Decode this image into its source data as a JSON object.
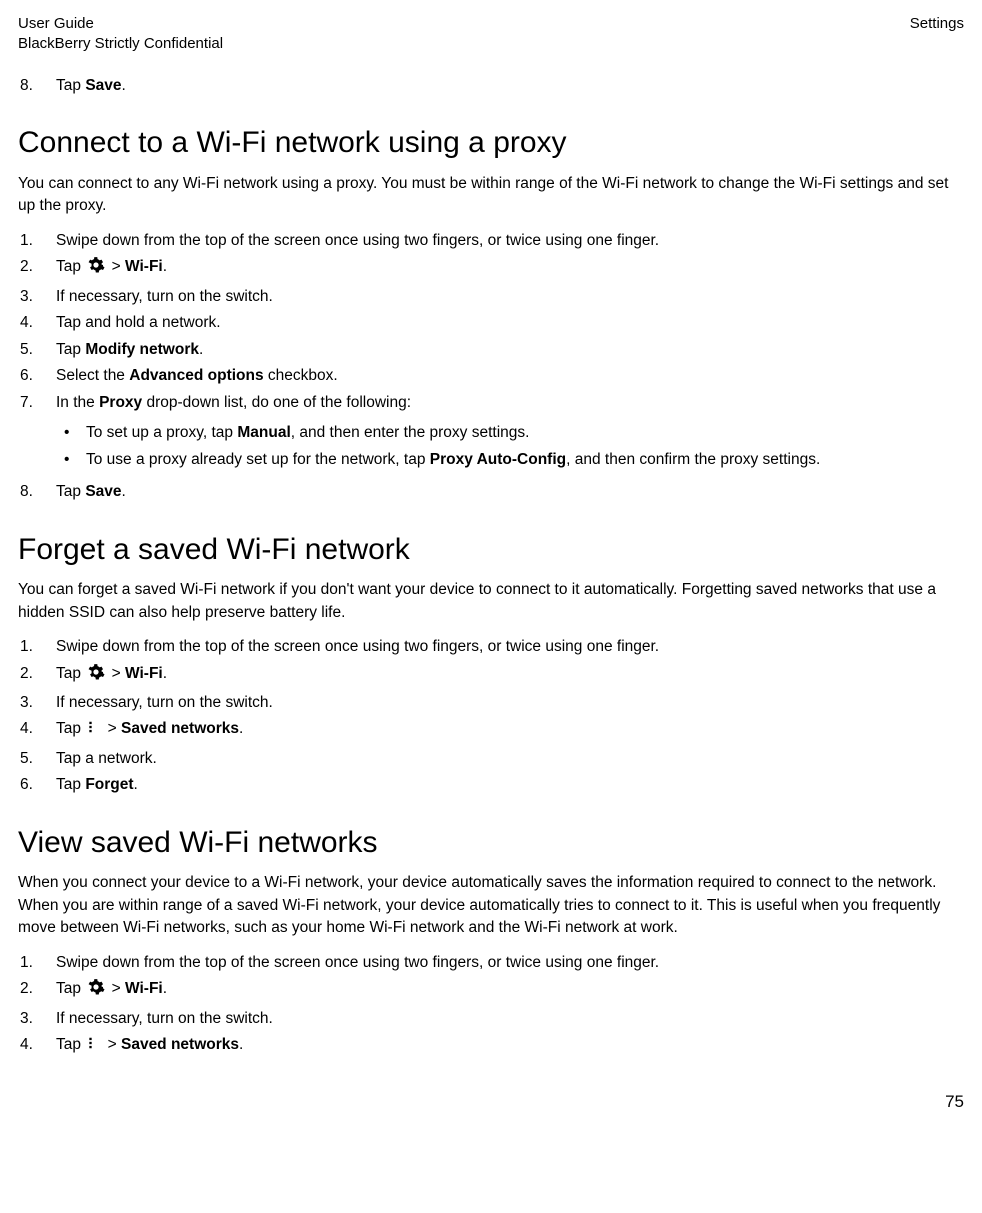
{
  "header": {
    "left_line1": "User Guide",
    "left_line2": "BlackBerry Strictly Confidential",
    "right": "Settings"
  },
  "top_step": {
    "num": "8.",
    "text_pre": "Tap ",
    "text_bold": "Save",
    "text_post": "."
  },
  "section1": {
    "title": "Connect to a Wi-Fi network using a proxy",
    "intro": "You can connect to any Wi-Fi network using a proxy. You must be within range of the Wi-Fi network to change the Wi-Fi settings and set up the proxy.",
    "steps": [
      {
        "num": "1.",
        "plain": "Swipe down from the top of the screen once using two fingers, or twice using one finger."
      },
      {
        "num": "2.",
        "tap": true,
        "pre": "Tap ",
        "mid": " > ",
        "bold": "Wi-Fi",
        "post": "."
      },
      {
        "num": "3.",
        "plain": "If necessary, turn on the switch."
      },
      {
        "num": "4.",
        "plain": "Tap and hold a network."
      },
      {
        "num": "5.",
        "pre": "Tap ",
        "bold": "Modify network",
        "post": "."
      },
      {
        "num": "6.",
        "pre": "Select the ",
        "bold": "Advanced options",
        "post": " checkbox."
      },
      {
        "num": "7.",
        "pre": "In the ",
        "bold": "Proxy",
        "post": " drop-down list, do one of the following:"
      }
    ],
    "bullets": [
      {
        "pre": "To set up a proxy, tap ",
        "bold": "Manual",
        "post": ", and then enter the proxy settings."
      },
      {
        "pre": "To use a proxy already set up for the network, tap ",
        "bold": "Proxy Auto-Config",
        "post": ", and then confirm the proxy settings."
      }
    ],
    "final": {
      "num": "8.",
      "pre": "Tap ",
      "bold": "Save",
      "post": "."
    }
  },
  "section2": {
    "title": "Forget a saved Wi-Fi network",
    "intro": "You can forget a saved Wi-Fi network if you don't want your device to connect to it automatically. Forgetting saved networks that use a hidden SSID can also help preserve battery life.",
    "steps": [
      {
        "num": "1.",
        "plain": "Swipe down from the top of the screen once using two fingers, or twice using one finger."
      },
      {
        "num": "2.",
        "tap_gear": true,
        "pre": "Tap ",
        "mid": " > ",
        "bold": "Wi-Fi",
        "post": "."
      },
      {
        "num": "3.",
        "plain": "If necessary, turn on the switch."
      },
      {
        "num": "4.",
        "tap_menu": true,
        "pre": "Tap ",
        "mid": " > ",
        "bold": "Saved networks",
        "post": "."
      },
      {
        "num": "5.",
        "plain": "Tap a network."
      },
      {
        "num": "6.",
        "pre": "Tap ",
        "bold": "Forget",
        "post": "."
      }
    ]
  },
  "section3": {
    "title": "View saved Wi-Fi networks",
    "intro": "When you connect your device to a Wi-Fi network, your device automatically saves the information required to connect to the network. When you are within range of a saved Wi-Fi network, your device automatically tries to connect to it. This is useful when you frequently move between Wi-Fi networks, such as your home Wi-Fi network and the Wi-Fi network at work.",
    "steps": [
      {
        "num": "1.",
        "plain": "Swipe down from the top of the screen once using two fingers, or twice using one finger."
      },
      {
        "num": "2.",
        "tap_gear": true,
        "pre": "Tap ",
        "mid": " > ",
        "bold": "Wi-Fi",
        "post": "."
      },
      {
        "num": "3.",
        "plain": "If necessary, turn on the switch."
      },
      {
        "num": "4.",
        "tap_menu": true,
        "pre": "Tap ",
        "mid": " > ",
        "bold": "Saved networks",
        "post": "."
      }
    ]
  },
  "page_number": "75"
}
